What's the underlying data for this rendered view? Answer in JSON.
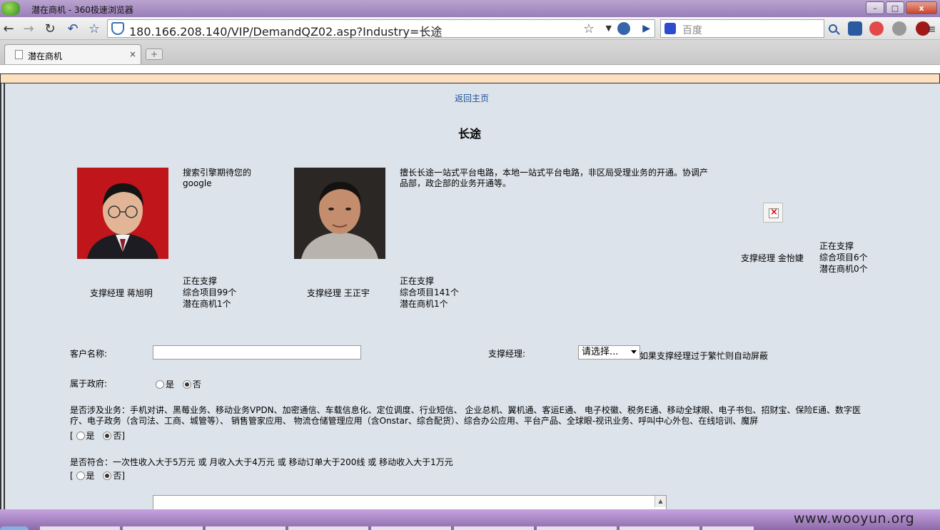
{
  "browser": {
    "window_title": "潜在商机 - 360极速浏览器",
    "url": "180.166.208.140/VIP/DemandQZ02.asp?Industry=长途",
    "search_engine": "百度",
    "tab_title": "潜在商机",
    "tab_close": "×",
    "new_tab": "+",
    "min": "–",
    "max": "□",
    "close": "x"
  },
  "page": {
    "back_link": "返回主页",
    "heading": "长途",
    "managers": [
      {
        "desc": "搜索引擎期待您的\ngoogle",
        "label": "支撑经理  蒋旭明",
        "stats": "正在支撑\n综合项目99个\n潜在商机1个"
      },
      {
        "desc": "擅长长途一站式平台电路，本地一站式平台电路，非区局受理业务的开通。协调产\n品部，政企部的业务开通等。",
        "label": "支撑经理  王正宇",
        "stats": "正在支撑\n综合项目141个\n潜在商机1个"
      },
      {
        "label": "支撑经理  金怡婕",
        "stats": "正在支撑\n综合项目6个\n潜在商机0个"
      }
    ],
    "form": {
      "customer_label": "客户名称:",
      "manager_label": "支撑经理:",
      "manager_select": "请选择...",
      "manager_note": "如果支撑经理过于繁忙则自动屏蔽",
      "gov_label": "属于政府:",
      "yes": "是",
      "no": "否",
      "business_text": "是否涉及业务：手机对讲、黑莓业务、移动业务VPDN、加密通信、车载信息化、定位调度、行业短信、 企业总机、翼机通、客运E通、 电子校徽、税务E通、移动全球眼、电子书包、招财宝、保险E通、数字医\n疗、电子政务（含司法、工商、城管等）、 销售管家应用、 物流仓储管理应用（含Onstar、综合配货）、综合办公应用、平台产品、全球眼-视讯业务、呼叫中心外包、在线培训、魔屏",
      "bracket_open": "[",
      "bracket_close": "]",
      "revenue_text": "是否符合：一次性收入大于5万元  或  月收入大于4万元  或  移动订单大于200线  或  移动收入大于1万元"
    }
  },
  "taskbar": {
    "watermark": "www.wooyun.org"
  }
}
